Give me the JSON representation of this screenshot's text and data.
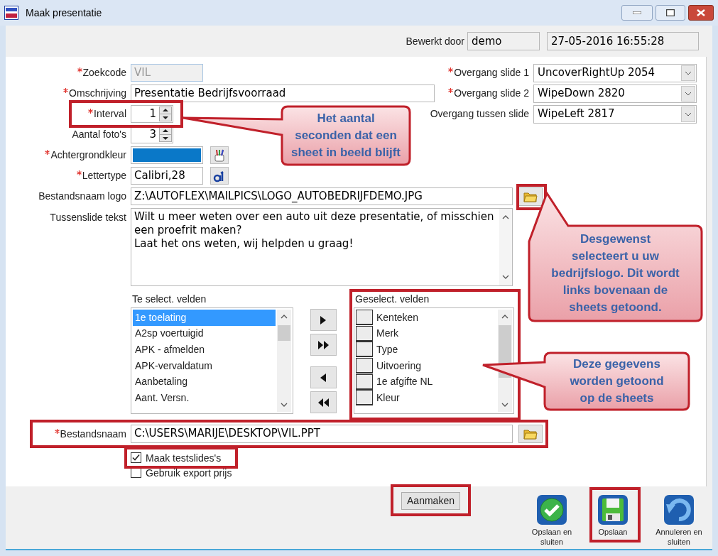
{
  "window": {
    "title": "Maak presentatie"
  },
  "header": {
    "edited_by_label": "Bewerkt door",
    "edited_by": "demo",
    "timestamp": "27-05-2016 16:55:28"
  },
  "fields": [
    {
      "kind": "code",
      "label": "Zoekcode",
      "required": true,
      "value": "VIL",
      "disabled": true
    },
    {
      "kind": "text",
      "label": "Omschrijving",
      "required": true,
      "value": "Presentatie Bedrijfsvoorraad"
    },
    {
      "kind": "spin",
      "label": "Interval",
      "required": true,
      "value": "1"
    },
    {
      "kind": "spin",
      "label": "Aantal foto's",
      "required": false,
      "value": "3"
    },
    {
      "kind": "color",
      "label": "Achtergrondkleur",
      "required": true,
      "color": "#0a78c8"
    },
    {
      "kind": "font",
      "label": "Lettertype",
      "required": true,
      "value": "Calibri,28"
    },
    {
      "kind": "file",
      "label": "Bestandsnaam logo",
      "required": false,
      "value": "Z:\\AUTOFLEX\\MAILPICS\\LOGO_AUTOBEDRIJFDEMO.JPG"
    },
    {
      "kind": "textarea",
      "label": "Tussenslide tekst",
      "required": false,
      "value": "Wilt u meer weten over een auto uit deze presentatie, of misschien een proefrit maken?\nLaat het ons weten, wij helpden u graag!"
    }
  ],
  "transitions": [
    {
      "label": "Overgang slide 1",
      "required": true,
      "value": "UncoverRightUp 2054"
    },
    {
      "label": "Overgang slide 2",
      "required": true,
      "value": "WipeDown 2820"
    },
    {
      "label": "Overgang tussen slide",
      "required": false,
      "value": "WipeLeft 2817"
    }
  ],
  "available_fields": {
    "label": "Te select. velden",
    "items": [
      {
        "text": "1e toelating",
        "selected": true
      },
      {
        "text": "A2sp voertuigid",
        "selected": false
      },
      {
        "text": "APK - afmelden",
        "selected": false
      },
      {
        "text": "APK-vervaldatum",
        "selected": false
      },
      {
        "text": "Aanbetaling",
        "selected": false
      },
      {
        "text": "Aant. Versn.",
        "selected": false
      }
    ]
  },
  "selected_fields": {
    "label": "Geselect. velden",
    "items": [
      {
        "text": "Kenteken",
        "selected": false
      },
      {
        "text": "Merk",
        "selected": false
      },
      {
        "text": "Type",
        "selected": false
      },
      {
        "text": "Uitvoering",
        "selected": false
      },
      {
        "text": "1e afgifte NL",
        "selected": false
      },
      {
        "text": "Kleur",
        "selected": false
      }
    ]
  },
  "output_file": {
    "label": "Bestandsnaam",
    "required": true,
    "value": "C:\\USERS\\MARIJE\\DESKTOP\\VIL.PPT"
  },
  "options": [
    {
      "label": "Maak testslides's",
      "checked": true
    },
    {
      "label": "Gebruik export prijs",
      "checked": false
    }
  ],
  "create_button": {
    "label": "Aanmaken"
  },
  "actions": [
    {
      "kind": "save_close",
      "label": "Opslaan en sluiten"
    },
    {
      "kind": "save",
      "label": "Opslaan"
    },
    {
      "kind": "cancel",
      "label": "Annuleren en sluiten"
    }
  ],
  "callouts": [
    {
      "text": "Het aantal\nseconden dat een\nsheet in beeld blijft"
    },
    {
      "text": "Desgewenst\nselecteert u uw\nbedrijfslogo. Dit wordt\nlinks bovenaan de\nsheets getoond."
    },
    {
      "text": "Deze gegevens\nworden getoond\nop de sheets"
    }
  ]
}
